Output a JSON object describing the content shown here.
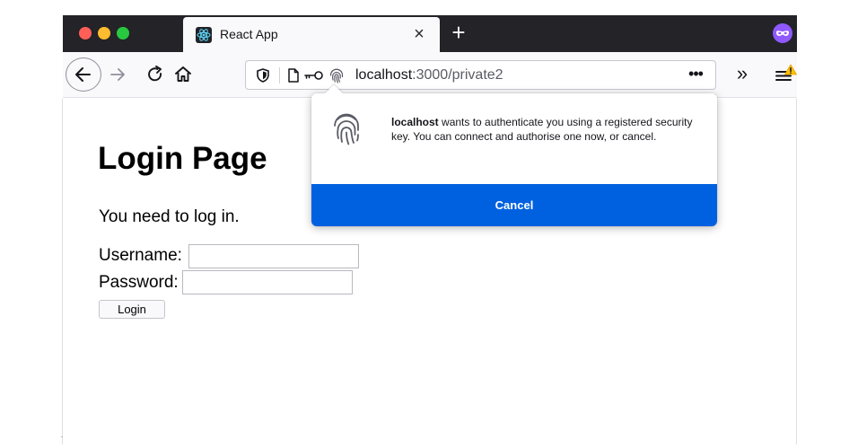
{
  "browser": {
    "tab": {
      "title": "React App",
      "close_glyph": "×"
    },
    "new_tab_glyph": "+",
    "toolbar": {
      "url_host": "localhost",
      "url_path": ":3000/private2",
      "page_actions_glyph": "•••",
      "overflow_glyph": "»"
    },
    "icons": {
      "tab_favicon": "react-logo-icon",
      "private_badge": "private-browsing-mask-icon",
      "back": "back-arrow-icon",
      "forward": "forward-arrow-icon",
      "reload": "reload-icon",
      "home": "home-icon",
      "shield": "tracking-protection-shield-icon",
      "page": "page-info-icon",
      "key": "key-icon",
      "fingerprint": "fingerprint-icon",
      "menu": "hamburger-menu-warning-icon"
    },
    "colors": {
      "tabstrip": "#232328",
      "accent_button": "#0061e0",
      "private_badge": "#9059ff",
      "warning": "#ffbf00"
    }
  },
  "page": {
    "title": "Login Page",
    "message": "You need to log in.",
    "username_label": "Username:",
    "password_label": "Password:",
    "username_value": "",
    "password_value": "",
    "login_button": "Login"
  },
  "auth_popup": {
    "host": "localhost",
    "message": " wants to authenticate you using a registered security key. You can connect and authorise one now, or cancel.",
    "cancel_button": "Cancel"
  }
}
